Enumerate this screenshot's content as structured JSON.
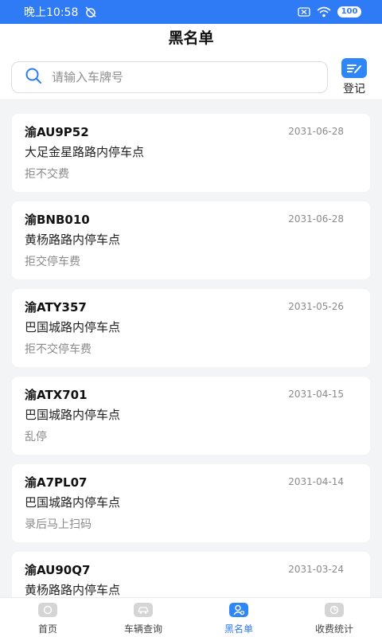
{
  "status_bar": {
    "time": "晚上10:58",
    "battery": "100"
  },
  "header": {
    "title": "黑名单",
    "search_placeholder": "请输入车牌号",
    "register_label": "登记"
  },
  "records": [
    {
      "plate": "渝AU9P52",
      "date": "2031-06-28",
      "location": "大足金星路路内停车点",
      "reason": "拒不交费"
    },
    {
      "plate": "渝BNB010",
      "date": "2031-06-28",
      "location": "黄杨路路内停车点",
      "reason": "拒交停车费"
    },
    {
      "plate": "渝ATY357",
      "date": "2031-05-26",
      "location": "巴国城路内停车点",
      "reason": "拒不交停车费"
    },
    {
      "plate": "渝ATX701",
      "date": "2031-04-15",
      "location": "巴国城路内停车点",
      "reason": "乱停"
    },
    {
      "plate": "渝A7PL07",
      "date": "2031-04-14",
      "location": "巴国城路内停车点",
      "reason": "录后马上扫码"
    },
    {
      "plate": "渝AU90Q7",
      "date": "2031-03-24",
      "location": "黄杨路路内停车点",
      "reason": ""
    }
  ],
  "tabs": [
    {
      "label": "首页",
      "icon": "home-icon"
    },
    {
      "label": "车辆查询",
      "icon": "car-icon"
    },
    {
      "label": "黑名单",
      "icon": "blacklist-icon"
    },
    {
      "label": "收费统计",
      "icon": "stats-icon"
    }
  ],
  "colors": {
    "accent": "#2f7bf5",
    "status_bar": "#2f7bf5",
    "inactive_icon": "#d5d5d5"
  }
}
